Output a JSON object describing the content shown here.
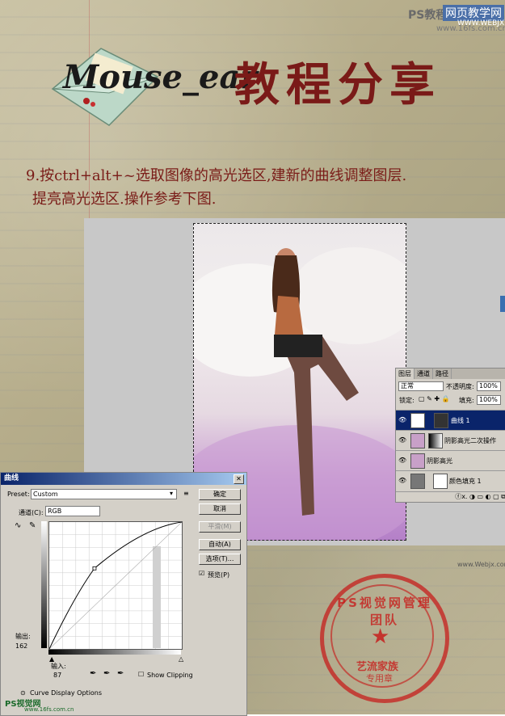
{
  "header": {
    "title_en": "Mouse_ear",
    "title_cn": "教程分享",
    "watermark_ps": "PS教程论坛",
    "watermark_ps_url": "www.16fs.com.cn",
    "watermark_site": "网页教学网",
    "watermark_site_url": "WWW.WEBJX.COM"
  },
  "instruction": {
    "line1": "9.按ctrl+alt+~选取图像的高光选区,建新的曲线调整图层.",
    "line2": "提亮高光选区.操作参考下图."
  },
  "watermark_mid": "www.Webjx.com",
  "layers_panel": {
    "tabs": [
      "图层",
      "通道",
      "路径"
    ],
    "blend_mode": "正常",
    "opacity_label": "不透明度:",
    "opacity_value": "100%",
    "lock_label": "锁定:",
    "fill_label": "填充:",
    "fill_value": "100%",
    "layers": [
      {
        "name": "曲线 1",
        "selected": true
      },
      {
        "name": "阴影高光二次操作",
        "selected": false
      },
      {
        "name": "阴影高光",
        "selected": false
      },
      {
        "name": "颜色填充 1",
        "selected": false
      }
    ],
    "bottom_icons": "ⓕx. ◑ ▭ ◐ ▢ ⧉"
  },
  "curves_dialog": {
    "title": "曲线",
    "preset_label": "Preset:",
    "preset_value": "Custom",
    "channel_label": "通道(C):",
    "channel_value": "RGB",
    "buttons": {
      "ok": "确定",
      "cancel": "取消",
      "smooth": "平滑(M)",
      "auto": "自动(A)",
      "options": "选项(T)..."
    },
    "preview_label": "预览(P)",
    "preview_checked": true,
    "output_label": "输出:",
    "output_value": "162",
    "input_label": "输入:",
    "input_value": "87",
    "show_clipping_label": "Show Clipping",
    "curve_display_label": "Curve Display Options",
    "curve_point": {
      "input": 87,
      "output": 162
    }
  },
  "stamp": {
    "arc_text": "PS视觉网管理团队",
    "line1": "艺流家族",
    "line2": "专用章"
  },
  "footer": {
    "logo": "PS视觉网",
    "url": "www.16fs.com.cn"
  }
}
